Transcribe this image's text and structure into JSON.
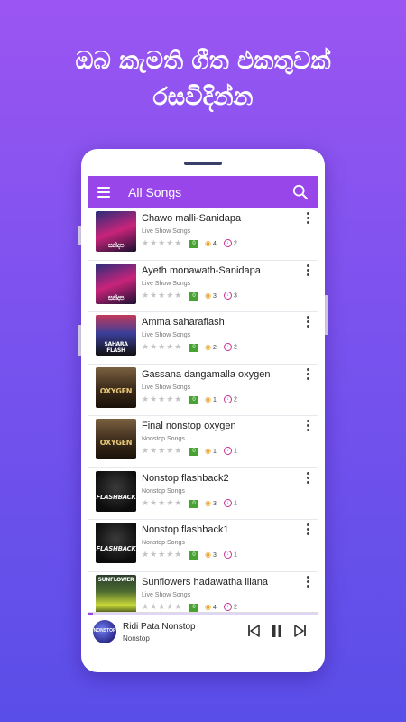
{
  "headline": {
    "line1": "ඔබ කැමති ගීත එකතුවක්",
    "line2": "රසවිදින්න"
  },
  "appbar": {
    "title": "All Songs",
    "menu_icon": "hamburger-menu-icon",
    "search_icon": "search-icon",
    "color": "#9846EA"
  },
  "songs": [
    {
      "title": "Chawo malli-Sanidapa",
      "category": "Live Show Songs",
      "rating_badge": "0",
      "views": "4",
      "downloads": "2",
      "thumb_text": "සනිදප"
    },
    {
      "title": "Ayeth monawath-Sanidapa",
      "category": "Live Show Songs",
      "rating_badge": "0",
      "views": "3",
      "downloads": "3",
      "thumb_text": "සනිදප"
    },
    {
      "title": "Amma saharaflash",
      "category": "Live Show Songs",
      "rating_badge": "0",
      "views": "2",
      "downloads": "2",
      "thumb_text": "SAHARA FLASH"
    },
    {
      "title": "Gassana dangamalla oxygen",
      "category": "Live Show Songs",
      "rating_badge": "0",
      "views": "1",
      "downloads": "2",
      "thumb_text": "OXYGEN"
    },
    {
      "title": "Final nonstop oxygen",
      "category": "Nonstop Songs",
      "rating_badge": "0",
      "views": "1",
      "downloads": "1",
      "thumb_text": "OXYGEN"
    },
    {
      "title": "Nonstop flashback2",
      "category": "Nonstop Songs",
      "rating_badge": "0",
      "views": "3",
      "downloads": "1",
      "thumb_text": "FLASHBACK"
    },
    {
      "title": "Nonstop flashback1",
      "category": "Nonstop Songs",
      "rating_badge": "0",
      "views": "3",
      "downloads": "1",
      "thumb_text": "FLASHBACK"
    },
    {
      "title": "Sunflowers hadawatha illana",
      "category": "Live Show Songs",
      "rating_badge": "0",
      "views": "4",
      "downloads": "2",
      "thumb_text": "SUNFLOWER"
    }
  ],
  "player": {
    "title": "Ridi Pata Nonstop",
    "subtitle": "Nonstop",
    "avatar_text": "NONSTOP",
    "progress": 0.02,
    "prev_icon": "skip-previous-icon",
    "pause_icon": "pause-icon",
    "next_icon": "skip-next-icon"
  },
  "colors": {
    "accent": "#9846EA",
    "badge": "#47A232",
    "views_icon": "#F0A020",
    "download_icon": "#C8349A"
  }
}
